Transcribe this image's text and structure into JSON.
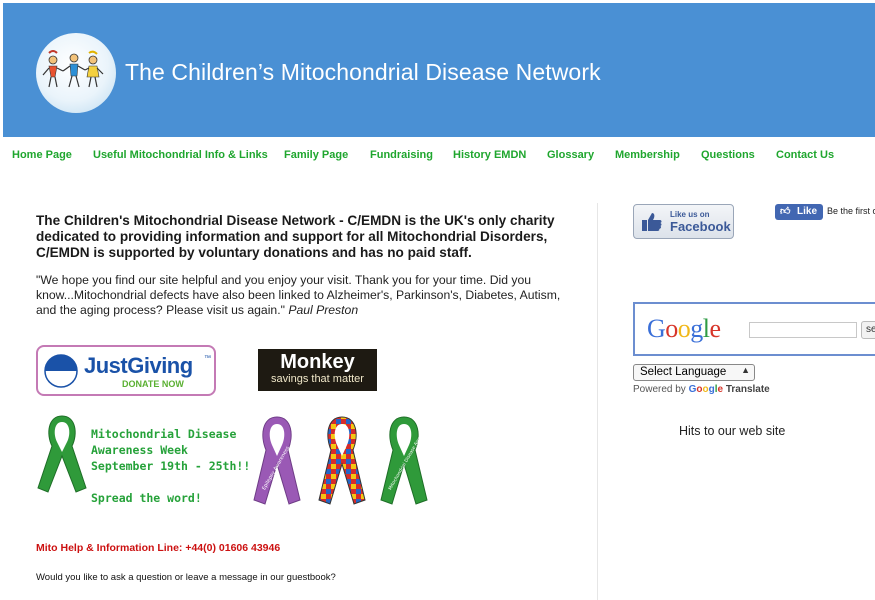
{
  "header": {
    "title": "The Children’s Mitochondrial Disease Network",
    "brand_color": "#4a90d4"
  },
  "nav": {
    "items": [
      {
        "label": "Home Page"
      },
      {
        "label": "Useful Mitochondrial Info & Links"
      },
      {
        "label": "Family Page"
      },
      {
        "label": "Fundraising"
      },
      {
        "label": "History EMDN"
      },
      {
        "label": "Glossary"
      },
      {
        "label": "Membership"
      },
      {
        "label": "Questions"
      },
      {
        "label": "Contact Us"
      }
    ],
    "color": "#1fa62e"
  },
  "main": {
    "intro": "The Children's Mitochondrial Disease Network - C/EMDN is the UK's only charity dedicated to providing information and support for all Mitochondrial Disorders, C/EMDN is supported by voluntary donations and has no paid staff.",
    "quote": "\"We hope you find our site helpful and you enjoy your visit. Thank you for your time. Did you know...Mitochondrial defects have also been linked to Alzheimer's, Parkinson's, Diabetes, Autism, and the aging process? Please visit us again.\"",
    "quote_author": "Paul Preston",
    "justgiving": {
      "name": "JustGiving",
      "sub": "DONATE NOW",
      "tm": "™"
    },
    "monkey": {
      "name": "Monkey",
      "sub": "savings that matter"
    },
    "awareness": {
      "line1": "Mitochondrial Disease",
      "line2": "Awareness Week",
      "line3": "September 19th - 25th!!",
      "line4": "Spread the word!"
    },
    "ribbon_purple_text": "Epilepsy Awareness",
    "ribbon_green_text": "Mitochondrial Disease Awareness",
    "helpline": "Mito Help & Information Line: +44(0) 01606 43946",
    "guestbook": "Would you like to ask a question or leave a message in our guestbook?"
  },
  "sidebar": {
    "fb_like_us_small": "Like us on",
    "fb_like_us_big": "Facebook",
    "fb_like_button": "Like",
    "fb_first": "Be the first of",
    "google_logo": "Google",
    "google_search_button": "se",
    "language_select": "Select Language",
    "powered_by": "Powered by",
    "powered_google": "Google",
    "powered_translate": "Translate",
    "hits": "Hits to our web site"
  }
}
